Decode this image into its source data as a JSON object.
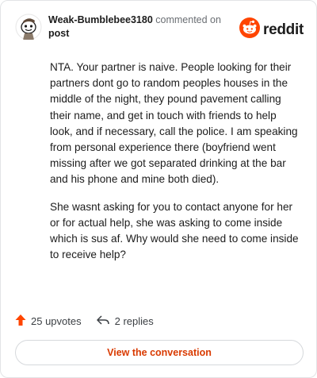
{
  "comment": {
    "username": "Weak-Bumblebee3180",
    "action_text": "commented on",
    "target": "post",
    "paragraphs": [
      "NTA. Your partner is naive. People looking for their partners dont go to random peoples houses in the middle of the night, they pound pavement calling their name, and get in touch with friends to help look, and if necessary, call the police. I am speaking from personal experience there (boyfriend went missing after we got separated drinking at the bar and his phone and mine both died).",
      "She wasnt asking for you to contact anyone for her or for actual help, she was asking to come inside which is sus af. Why would she need to come inside to receive help?"
    ],
    "upvotes_label": "25 upvotes",
    "replies_label": "2 replies"
  },
  "brand": {
    "wordmark": "reddit",
    "icon": "reddit-snoo-icon",
    "color": "#ff4500"
  },
  "cta": {
    "label": "View the conversation",
    "color": "#d93a00"
  },
  "icons": {
    "upvote": "upvote-arrow-icon",
    "reply": "reply-arrow-icon",
    "avatar": "snoo-avatar"
  }
}
